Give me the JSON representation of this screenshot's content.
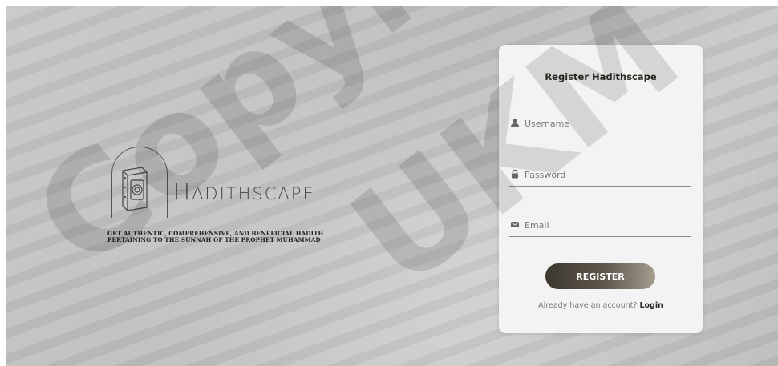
{
  "brand": {
    "name_lead": "H",
    "name_mid": "ADITH",
    "name_tail": "SCAPE",
    "tagline_line1": "GET AUTHENTIC, COMPREHENSIVE, AND BENEFICIAL HADITH",
    "tagline_line2": "PERTAINING TO THE SUNNAH OF THE PROPHET MUHAMMAD"
  },
  "watermark": {
    "text1": "Copyright",
    "text2": "UKM"
  },
  "register_form": {
    "title": "Register Hadithscape",
    "username_placeholder": "Username",
    "password_placeholder": "Password",
    "email_placeholder": "Email",
    "submit_label": "REGISTER",
    "login_prompt": "Already have an account?",
    "login_link": "Login"
  },
  "icons": {
    "username": "user-icon",
    "password": "lock-icon",
    "email": "envelope-icon"
  },
  "colors": {
    "button_dark": "#3d3830",
    "button_light": "#a59e8f",
    "card_bg": "#f3f3f3",
    "title_text": "#2e2a24"
  }
}
